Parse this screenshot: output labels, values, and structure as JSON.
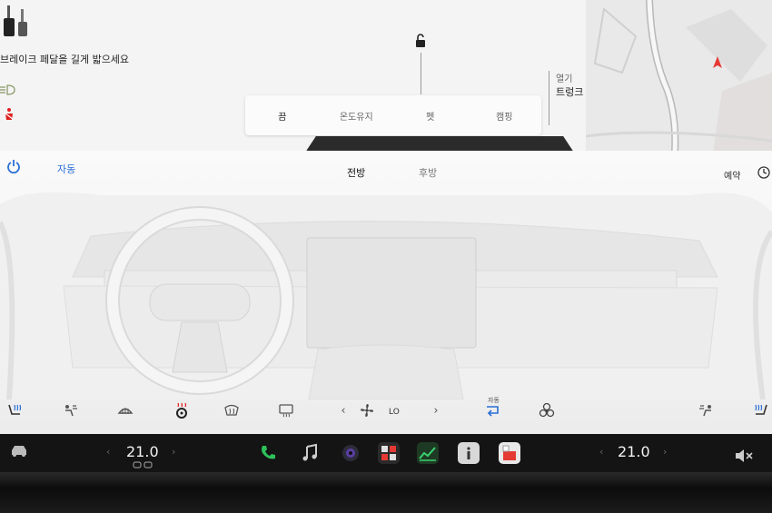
{
  "status": {
    "brake_message": "브레이크 페달을 길게 밟으세요",
    "icons": [
      "pedal-icon",
      "headlight-icon",
      "seatbelt-warning-icon",
      "lock-icon"
    ]
  },
  "trunk": {
    "action": "열기",
    "label": "트렁크"
  },
  "modes": [
    {
      "label": "끔",
      "active": true
    },
    {
      "label": "온도유지",
      "active": false
    },
    {
      "label": "펫",
      "active": false
    },
    {
      "label": "캠핑",
      "active": false
    }
  ],
  "climate": {
    "auto_label": "자동",
    "tabs": {
      "front": "전방",
      "rear": "후방"
    },
    "schedule_label": "예약",
    "fan_speed": "LO",
    "recirc_label": "자동"
  },
  "dock": {
    "driver_temp": "21.0",
    "passenger_temp": "21.0"
  },
  "colors": {
    "accent": "#2a6fd6",
    "warning": "#e02020",
    "nav_arrow": "#e53935"
  }
}
